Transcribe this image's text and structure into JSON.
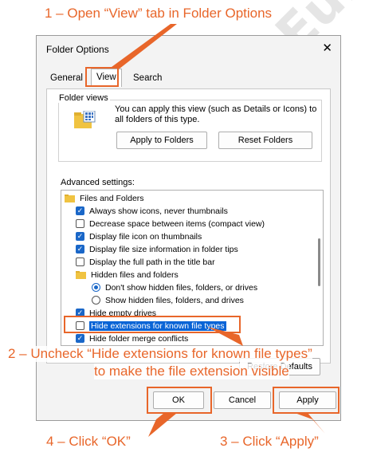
{
  "annotations": {
    "step1": "1 – Open “View” tab in Folder Options",
    "step2_line1": "2 – Uncheck “Hide extensions for known file types”",
    "step2_line2": "to make the file extension visible",
    "step3": "3 – Click “Apply”",
    "step4": "4 – Click “OK”",
    "watermark": "OnlinePlusEu.com",
    "accent_color": "#e8662a"
  },
  "dialog": {
    "title": "Folder Options",
    "close_glyph": "✕",
    "tabs": [
      {
        "label": "General"
      },
      {
        "label": "View"
      },
      {
        "label": "Search"
      }
    ],
    "folder_views": {
      "label": "Folder views",
      "description": "You can apply this view (such as Details or Icons) to all folders of this type.",
      "apply_button": "Apply to Folders",
      "reset_button": "Reset Folders"
    },
    "advanced": {
      "label": "Advanced settings:",
      "items": [
        {
          "type": "folder",
          "label": "Files and Folders"
        },
        {
          "type": "checkbox",
          "checked": true,
          "label": "Always show icons, never thumbnails"
        },
        {
          "type": "checkbox",
          "checked": false,
          "label": "Decrease space between items (compact view)"
        },
        {
          "type": "checkbox",
          "checked": true,
          "label": "Display file icon on thumbnails"
        },
        {
          "type": "checkbox",
          "checked": true,
          "label": "Display file size information in folder tips"
        },
        {
          "type": "checkbox",
          "checked": false,
          "label": "Display the full path in the title bar"
        },
        {
          "type": "folder",
          "label": "Hidden files and folders"
        },
        {
          "type": "radio",
          "checked": true,
          "label": "Don't show hidden files, folders, or drives"
        },
        {
          "type": "radio",
          "checked": false,
          "label": "Show hidden files, folders, and drives"
        },
        {
          "type": "checkbox",
          "checked": true,
          "label": "Hide empty drives"
        },
        {
          "type": "checkbox",
          "checked": false,
          "label": "Hide extensions for known file types",
          "selected": true
        },
        {
          "type": "checkbox",
          "checked": true,
          "label": "Hide folder merge conflicts"
        }
      ],
      "restore_button": "Restore Defaults"
    },
    "buttons": {
      "ok": "OK",
      "cancel": "Cancel",
      "apply": "Apply"
    }
  }
}
